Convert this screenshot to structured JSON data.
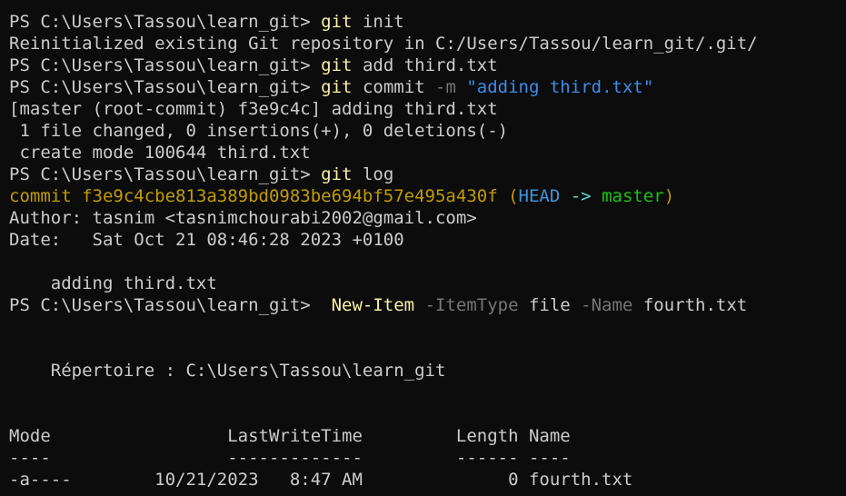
{
  "terminal": {
    "prompt": "PS C:\\Users\\Tassou\\learn_git> ",
    "git": "git",
    "cmd1_rest": " init",
    "out1": "Reinitialized existing Git repository in C:/Users/Tassou/learn_git/.git/",
    "cmd2_rest": " add third.txt",
    "cmd3_mid": " commit ",
    "cmd3_flag": "-m",
    "cmd3_sp": " ",
    "cmd3_msg": "\"adding third.txt\"",
    "out3a": "[master (root-commit) f3e9c4c] adding third.txt",
    "out3b": " 1 file changed, 0 insertions(+), 0 deletions(-)",
    "out3c": " create mode 100644 third.txt",
    "cmd4_rest": " log",
    "log_commit": "commit f3e9c4cbe813a389bd0983be694bf57e495a430f ",
    "log_paren_open": "(",
    "log_head": "HEAD",
    "log_arrow": " -> ",
    "log_branch": "master",
    "log_paren_close": ")",
    "log_author": "Author: tasnim <tasnimchourabi2002@gmail.com>",
    "log_date": "Date:   Sat Oct 21 08:46:28 2023 +0100",
    "log_msg": "    adding third.txt",
    "ni_prompt": "PS C:\\Users\\Tassou\\learn_git>  ",
    "ni_cmd": "New-Item",
    "ni_sp1": " ",
    "ni_p1": "-ItemType",
    "ni_v1": " file ",
    "ni_p2": "-Name",
    "ni_v2": " fourth.txt",
    "dir_line": "    Répertoire : C:\\Users\\Tassou\\learn_git",
    "table_header": "Mode                 LastWriteTime         Length Name",
    "table_sep": "----                 -------------         ------ ----",
    "table_row": "-a----        10/21/2023   8:47 AM              0 fourth.txt"
  }
}
